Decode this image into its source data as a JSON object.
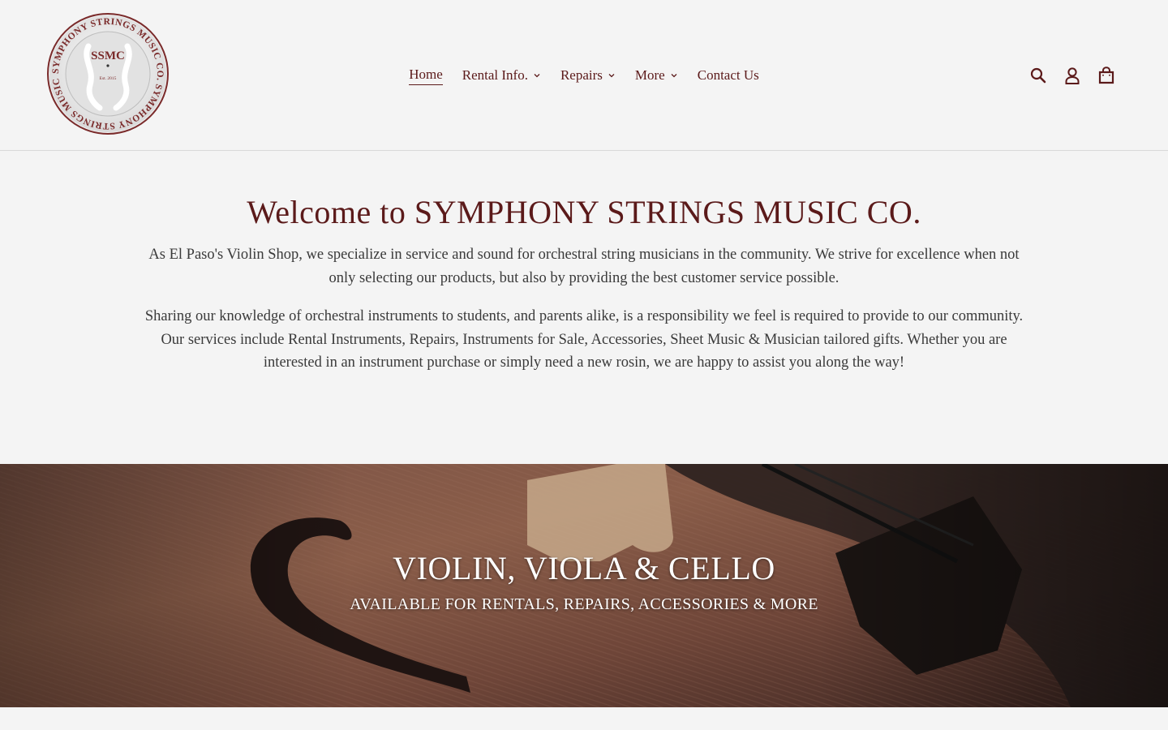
{
  "logo": {
    "ring_text": "SYMPHONY STRINGS MUSIC CO. SYMPHONY STRINGS MUSIC CO.",
    "initials": "SSMC",
    "established": "Est. 2015"
  },
  "nav": {
    "items": [
      {
        "label": "Home",
        "active": true,
        "dropdown": false
      },
      {
        "label": "Rental Info.",
        "active": false,
        "dropdown": true
      },
      {
        "label": "Repairs",
        "active": false,
        "dropdown": true
      },
      {
        "label": "More",
        "active": false,
        "dropdown": true
      },
      {
        "label": "Contact Us",
        "active": false,
        "dropdown": false
      }
    ]
  },
  "header_icons": [
    "search-icon",
    "account-icon",
    "cart-icon"
  ],
  "welcome": {
    "title": "Welcome to SYMPHONY STRINGS MUSIC CO.",
    "paragraph_1": "As El Paso's Violin Shop, we specialize in service and sound for orchestral string musicians in the community. We strive for excellence when not only selecting our products, but also by providing the best customer service possible.",
    "paragraph_2": "Sharing our knowledge of orchestral instruments to students, and parents alike, is a responsibility we feel is required to provide to our community. Our services include Rental Instruments, Repairs, Instruments for Sale, Accessories, Sheet Music & Musician tailored gifts. Whether you are interested in an instrument purchase or simply need a new rosin, we are happy to assist you along the way!"
  },
  "hero": {
    "title": "VIOLIN, VIOLA & CELLO",
    "subtitle": "AVAILABLE FOR RENTALS, REPAIRS, ACCESSORIES & MORE"
  },
  "colors": {
    "brand": "#5b1a1a",
    "background": "#f4f4f4",
    "body_text": "#3a3a3a",
    "divider": "#d9d9d9"
  }
}
